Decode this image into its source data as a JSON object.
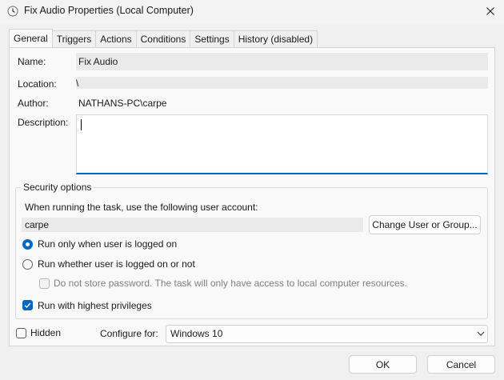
{
  "window": {
    "title": "Fix Audio Properties (Local Computer)"
  },
  "tabs": [
    {
      "label": "General",
      "active": true
    },
    {
      "label": "Triggers"
    },
    {
      "label": "Actions"
    },
    {
      "label": "Conditions"
    },
    {
      "label": "Settings"
    },
    {
      "label": "History (disabled)"
    }
  ],
  "general": {
    "name_label": "Name:",
    "name_value": "Fix Audio",
    "location_label": "Location:",
    "location_value": "\\",
    "author_label": "Author:",
    "author_value": "NATHANS-PC\\carpe",
    "description_label": "Description:",
    "description_value": ""
  },
  "security": {
    "title": "Security options",
    "account_prompt": "When running the task, use the following user account:",
    "account_value": "carpe",
    "change_user_button": "Change User or Group...",
    "run_logged_on": "Run only when user is logged on",
    "run_whether": "Run whether user is logged on or not",
    "do_not_store": "Do not store password.  The task will only have access to local computer resources.",
    "highest_privileges": "Run with highest privileges"
  },
  "bottom": {
    "hidden_label": "Hidden",
    "configure_label": "Configure for:",
    "configure_value": "Windows 10"
  },
  "footer": {
    "ok_label": "OK",
    "cancel_label": "Cancel"
  },
  "colors": {
    "accent": "#0067c0"
  },
  "icons": [
    "task-scheduler-clock-icon",
    "close-icon",
    "chevron-down-icon"
  ]
}
